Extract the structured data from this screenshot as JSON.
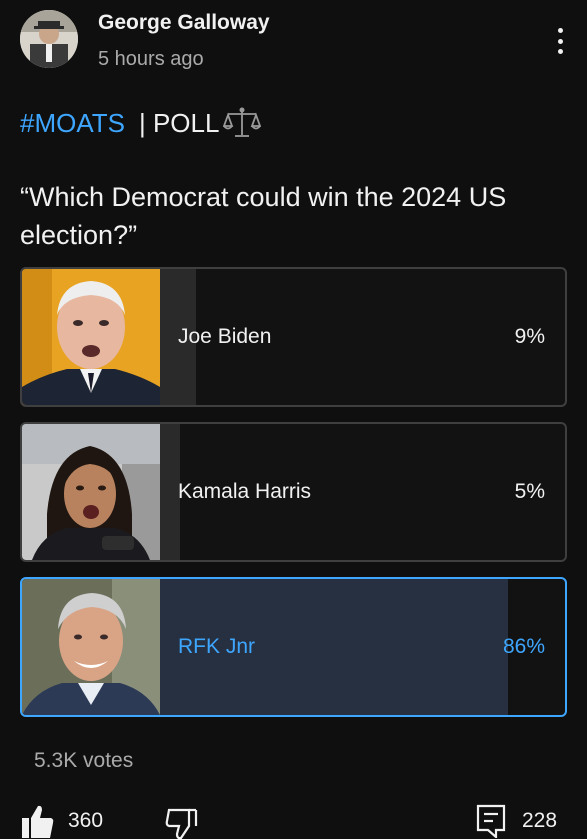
{
  "post": {
    "author": "George Galloway",
    "timestamp": "5 hours ago",
    "hashtag": "#MOATS",
    "label": "| POLL",
    "label_icon": "scales-icon",
    "question": "“Which Democrat could win the 2024 US election?”"
  },
  "poll": {
    "options": [
      {
        "label": "Joe Biden",
        "percent_text": "9%",
        "percent": 9,
        "selected": false
      },
      {
        "label": "Kamala Harris",
        "percent_text": "5%",
        "percent": 5,
        "selected": false
      },
      {
        "label": "RFK Jnr",
        "percent_text": "86%",
        "percent": 86,
        "selected": true
      }
    ],
    "votes": "5.3K votes"
  },
  "actions": {
    "like_count": "360",
    "comment_count": "228",
    "like_icon": "thumbs-up-icon",
    "dislike_icon": "thumbs-down-icon",
    "comment_icon": "comment-icon",
    "menu_icon": "more-vertical-icon"
  },
  "colors": {
    "background": "#0f0f0f",
    "accent": "#3ea6ff",
    "selected_fill": "#263040",
    "bar_fill": "#2a2a2a",
    "secondary_text": "#aaaaaa"
  }
}
